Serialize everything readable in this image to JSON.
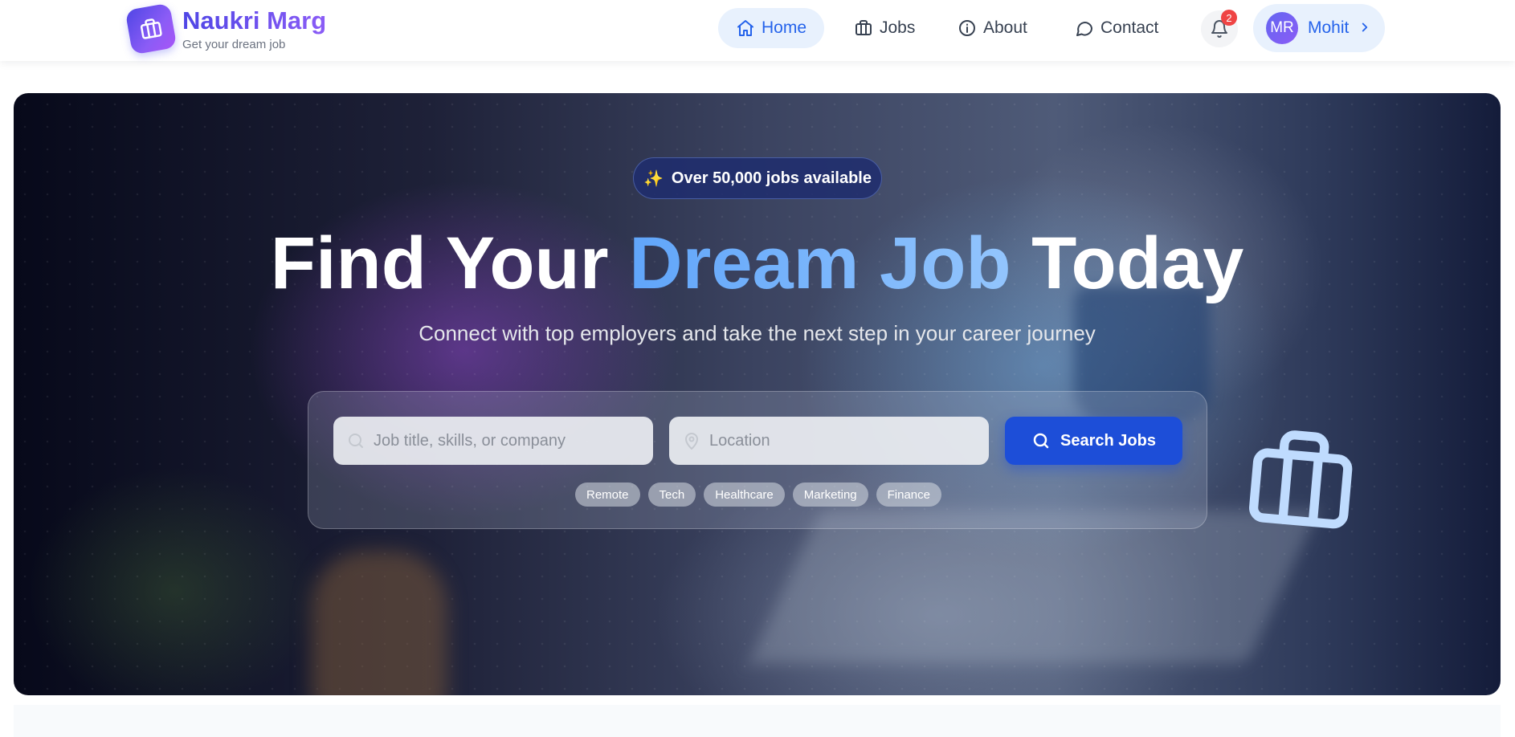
{
  "brand": {
    "name": "Naukri Marg",
    "tagline": "Get your dream job",
    "logo_icon": "briefcase-icon",
    "colors": {
      "brand_start": "#4f46e5",
      "brand_end": "#a855f7"
    }
  },
  "nav": {
    "items": [
      {
        "label": "Home",
        "icon": "home-icon",
        "active": true
      },
      {
        "label": "Jobs",
        "icon": "briefcase-icon",
        "active": false
      },
      {
        "label": "About",
        "icon": "info-icon",
        "active": false
      },
      {
        "label": "Contact",
        "icon": "chat-icon",
        "active": false
      }
    ],
    "notifications": {
      "icon": "bell-icon",
      "count": "2"
    },
    "user": {
      "initials": "MR",
      "name": "Mohit"
    },
    "colors": {
      "active_bg": "#e8f1fd",
      "active_text": "#2563eb",
      "badge": "#ef4444"
    }
  },
  "hero": {
    "badge": "Over 50,000 jobs available",
    "headline": {
      "part1": "Find Your ",
      "highlight": "Dream Job",
      "part2": " Today"
    },
    "subheadline": "Connect with top employers and take the next step in your career journey",
    "search": {
      "job_placeholder": "Job title, skills, or company",
      "location_placeholder": "Location",
      "button_label": "Search Jobs"
    },
    "tags": [
      "Remote",
      "Tech",
      "Healthcare",
      "Marketing",
      "Finance"
    ],
    "colors": {
      "highlight": "#60a5fa",
      "button": "#1d4ed8"
    }
  }
}
